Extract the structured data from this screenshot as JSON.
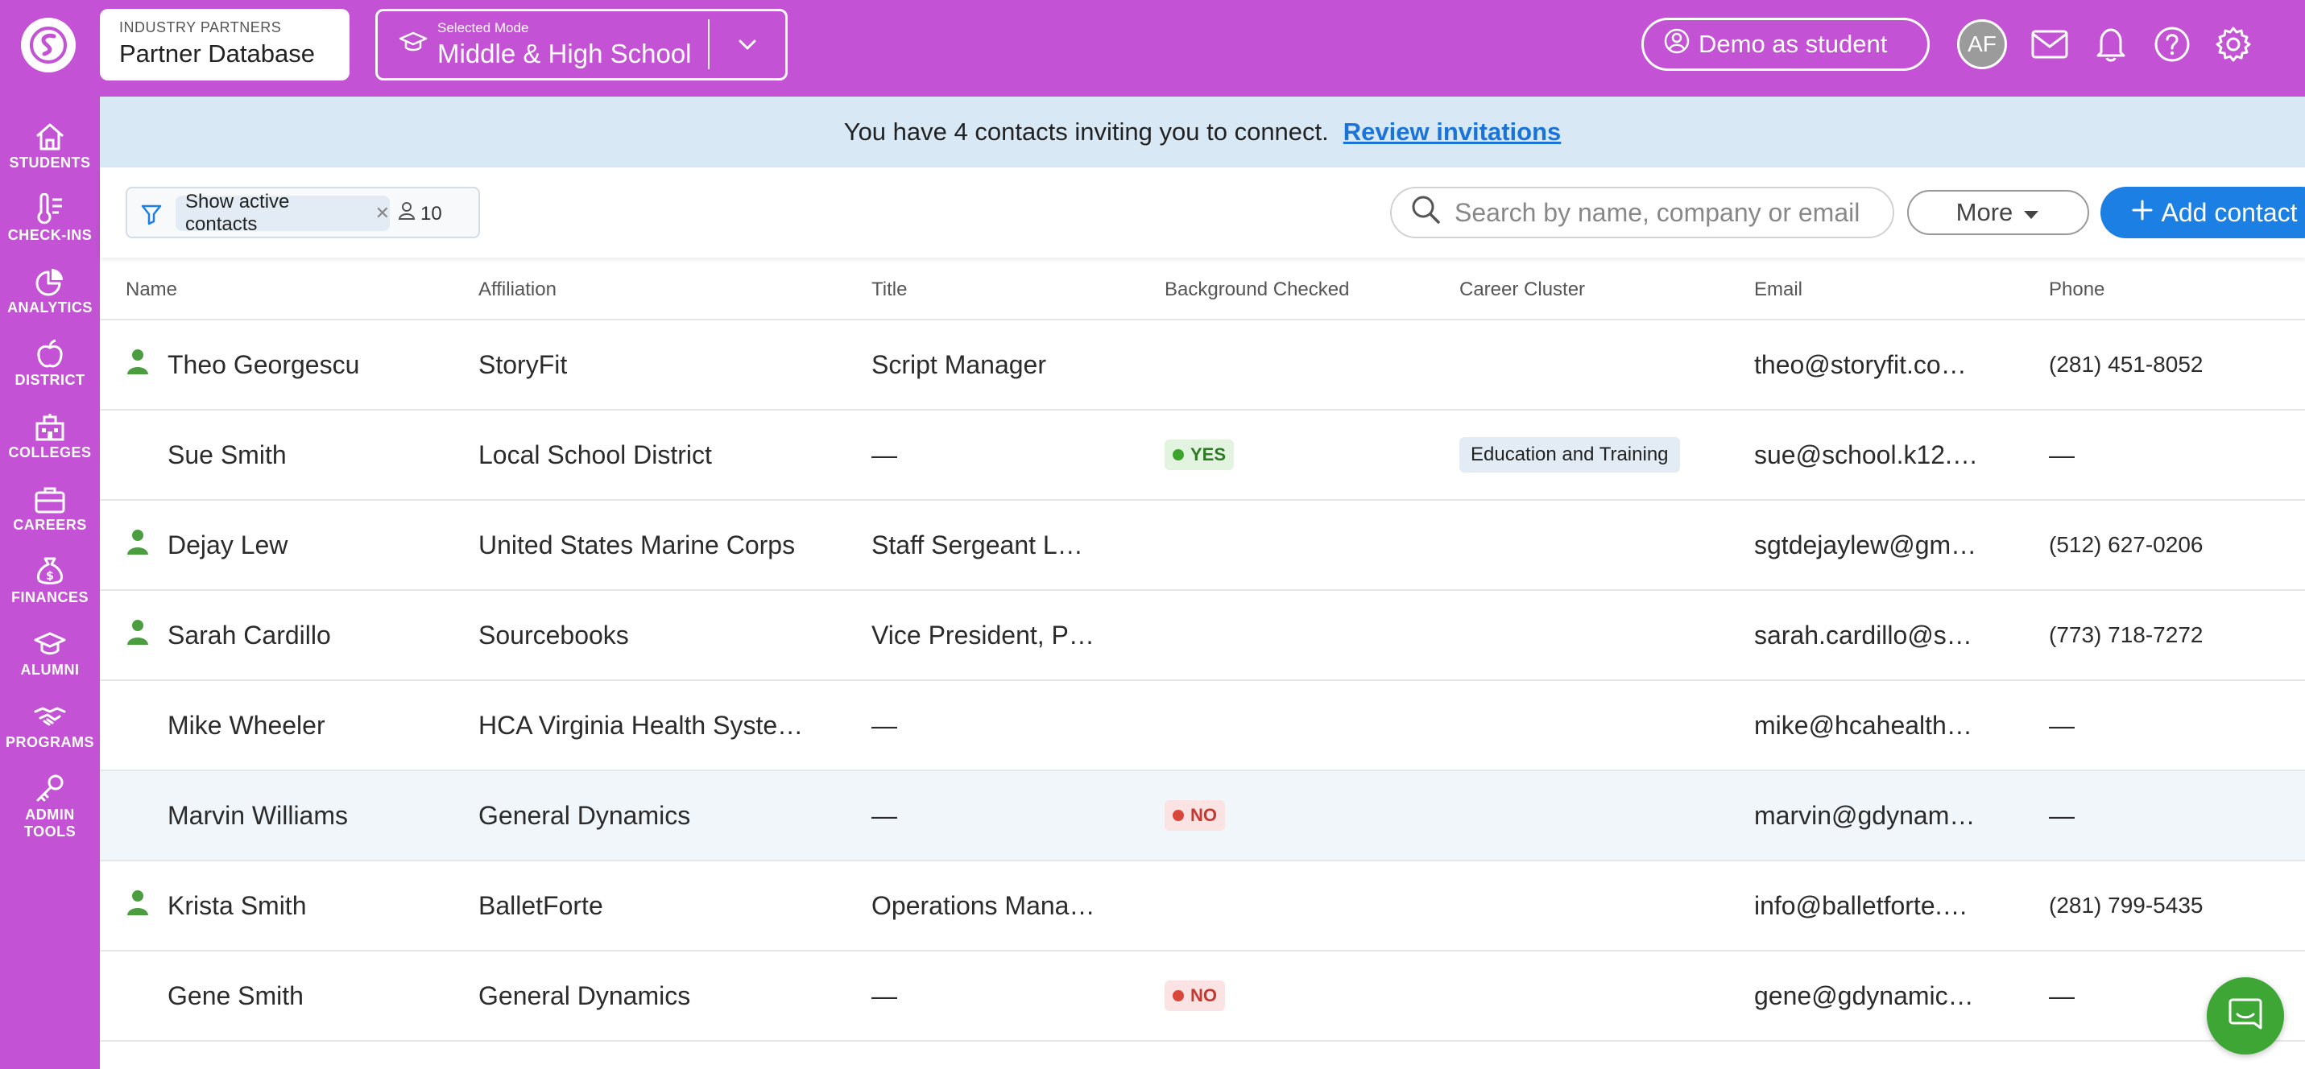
{
  "app": {
    "logo_icon": "swoosh-logo-icon"
  },
  "header": {
    "partner_kicker": "INDUSTRY PARTNERS",
    "partner_title": "Partner Database",
    "mode_kicker": "Selected Mode",
    "mode_value": "Middle & High School",
    "demo_label": "Demo as student",
    "avatar_initials": "AF"
  },
  "sidebar": {
    "items": [
      {
        "label": "STUDENTS",
        "icon": "home-icon"
      },
      {
        "label": "CHECK-INS",
        "icon": "thermometer-icon"
      },
      {
        "label": "ANALYTICS",
        "icon": "pie-chart-icon"
      },
      {
        "label": "DISTRICT",
        "icon": "apple-icon"
      },
      {
        "label": "COLLEGES",
        "icon": "building-icon"
      },
      {
        "label": "CAREERS",
        "icon": "briefcase-icon"
      },
      {
        "label": "FINANCES",
        "icon": "money-bag-icon"
      },
      {
        "label": "ALUMNI",
        "icon": "graduation-cap-icon"
      },
      {
        "label": "PROGRAMS",
        "icon": "handshake-icon"
      },
      {
        "label": "ADMIN",
        "label2": "TOOLS",
        "icon": "key-icon"
      }
    ]
  },
  "banner": {
    "text": "You have 4 contacts inviting you to connect.",
    "link": "Review invitations"
  },
  "toolbar": {
    "filter_chip": "Show active contacts",
    "count": "10",
    "search_placeholder": "Search by name, company or email",
    "more_label": "More",
    "add_label": "Add contact"
  },
  "table": {
    "columns": [
      "Name",
      "Affiliation",
      "Title",
      "Background Checked",
      "Career Cluster",
      "Email",
      "Phone"
    ],
    "rows": [
      {
        "active": true,
        "name": "Theo Georgescu",
        "affiliation": "StoryFit",
        "title": "Script Manager",
        "bg": "",
        "cluster": "",
        "email": "theo@storyfit.co…",
        "phone": "(281) 451-8052"
      },
      {
        "active": false,
        "name": "Sue Smith",
        "affiliation": "Local School District",
        "title": "—",
        "bg": "YES",
        "cluster": "Education and Training",
        "email": "sue@school.k12.…",
        "phone": "—"
      },
      {
        "active": true,
        "name": "Dejay Lew",
        "affiliation": "United States Marine Corps",
        "title": "Staff Sergeant L…",
        "bg": "",
        "cluster": "",
        "email": "sgtdejaylew@gm…",
        "phone": "(512) 627-0206"
      },
      {
        "active": true,
        "name": "Sarah Cardillo",
        "affiliation": "Sourcebooks",
        "title": "Vice President, P…",
        "bg": "",
        "cluster": "",
        "email": "sarah.cardillo@s…",
        "phone": "(773) 718-7272"
      },
      {
        "active": false,
        "name": "Mike Wheeler",
        "affiliation": "HCA Virginia Health Syste…",
        "title": "—",
        "bg": "",
        "cluster": "",
        "email": "mike@hcahealth…",
        "phone": "—"
      },
      {
        "active": false,
        "name": "Marvin Williams",
        "affiliation": "General Dynamics",
        "title": "—",
        "bg": "NO",
        "cluster": "",
        "email": "marvin@gdynam…",
        "phone": "—"
      },
      {
        "active": true,
        "name": "Krista Smith",
        "affiliation": "BalletForte",
        "title": "Operations Mana…",
        "bg": "",
        "cluster": "",
        "email": "info@balletforte.…",
        "phone": "(281) 799-5435"
      },
      {
        "active": false,
        "name": "Gene Smith",
        "affiliation": "General Dynamics",
        "title": "—",
        "bg": "NO",
        "cluster": "",
        "email": "gene@gdynamic…",
        "phone": "—"
      }
    ]
  },
  "colors": {
    "brand": "#c353d4",
    "accent": "#1b7fe3",
    "active_person": "#4a9e3f",
    "chat": "#3da635"
  }
}
